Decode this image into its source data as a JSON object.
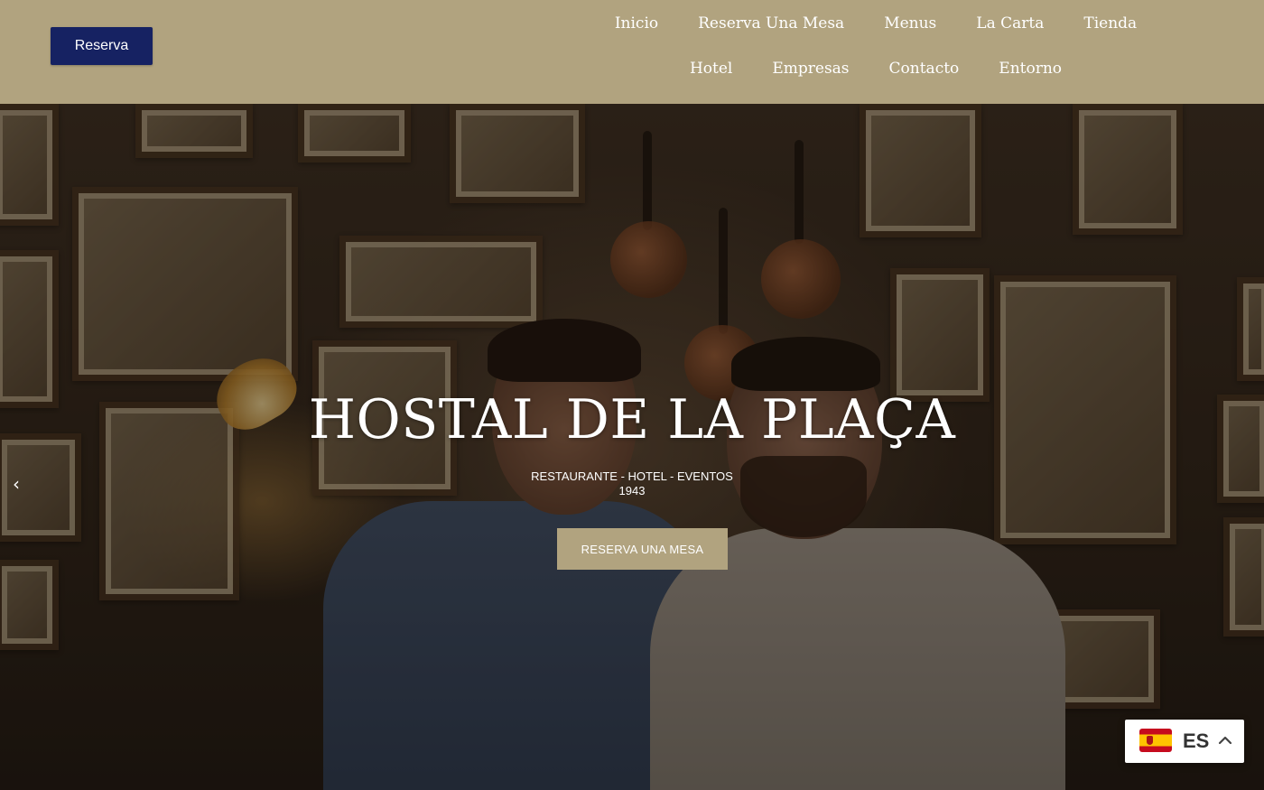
{
  "header": {
    "reserve_button": "Reserva",
    "nav_row1": [
      "Inicio",
      "Reserva Una Mesa",
      "Menus",
      "La Carta",
      "Tienda"
    ],
    "nav_row2": [
      "Hotel",
      "Empresas",
      "Contacto",
      "Entorno"
    ]
  },
  "hero": {
    "title": "HOSTAL DE LA PLAÇA",
    "subtitle_line1": "RESTAURANTE - HOTEL - EVENTOS",
    "subtitle_line2": "1943",
    "cta_label": "RESERVA UNA MESA",
    "prev_arrow": "‹"
  },
  "language_selector": {
    "code": "ES",
    "flag": "spain-flag-icon",
    "toggle_icon": "chevron-up-icon"
  },
  "colors": {
    "header_bg": "#b1a37f",
    "reserve_button_bg": "#162262",
    "cta_bg": "#b1a37f"
  }
}
